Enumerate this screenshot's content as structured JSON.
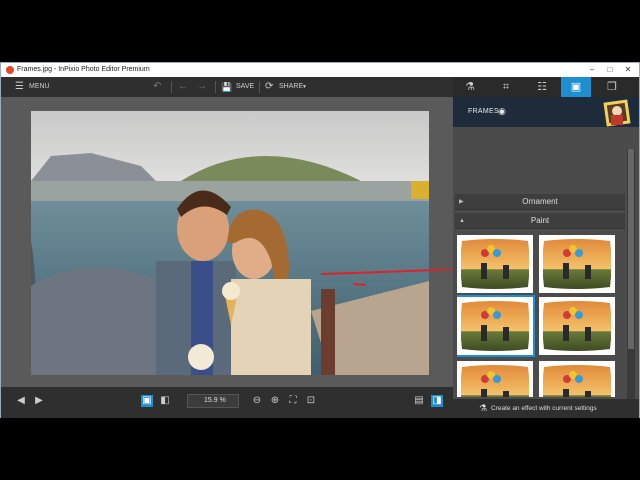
{
  "window": {
    "title": "Frames.jpg - InPixio Photo Editor Premium"
  },
  "titlebar_controls": [
    "–",
    "□",
    "✕"
  ],
  "toolbar": {
    "menu_label": "MENU",
    "save_label": "SAVE",
    "share_label": "SHARE"
  },
  "bottom": {
    "zoom_value": "15.9 %"
  },
  "panel": {
    "frames_label": "FRAMES",
    "sections": [
      {
        "label": "Ornament",
        "expanded": false
      },
      {
        "label": "Paint",
        "expanded": true
      }
    ],
    "footer_label": "Create an effect with current settings"
  },
  "icons": {
    "menu": "☰",
    "undo": "↶",
    "back": "←",
    "forward": "→",
    "save": "💾",
    "share": "⟳",
    "flask": "⚗",
    "crop": "⌗",
    "sliders": "☷",
    "frame": "▣",
    "layers": "❐",
    "prev": "◀",
    "next": "▶",
    "eye": "👁"
  },
  "colors": {
    "accent": "#1d8fd0",
    "toolbar": "#2f2f2f",
    "panel": "#4b4b4b",
    "annotation": "#e0202a"
  }
}
